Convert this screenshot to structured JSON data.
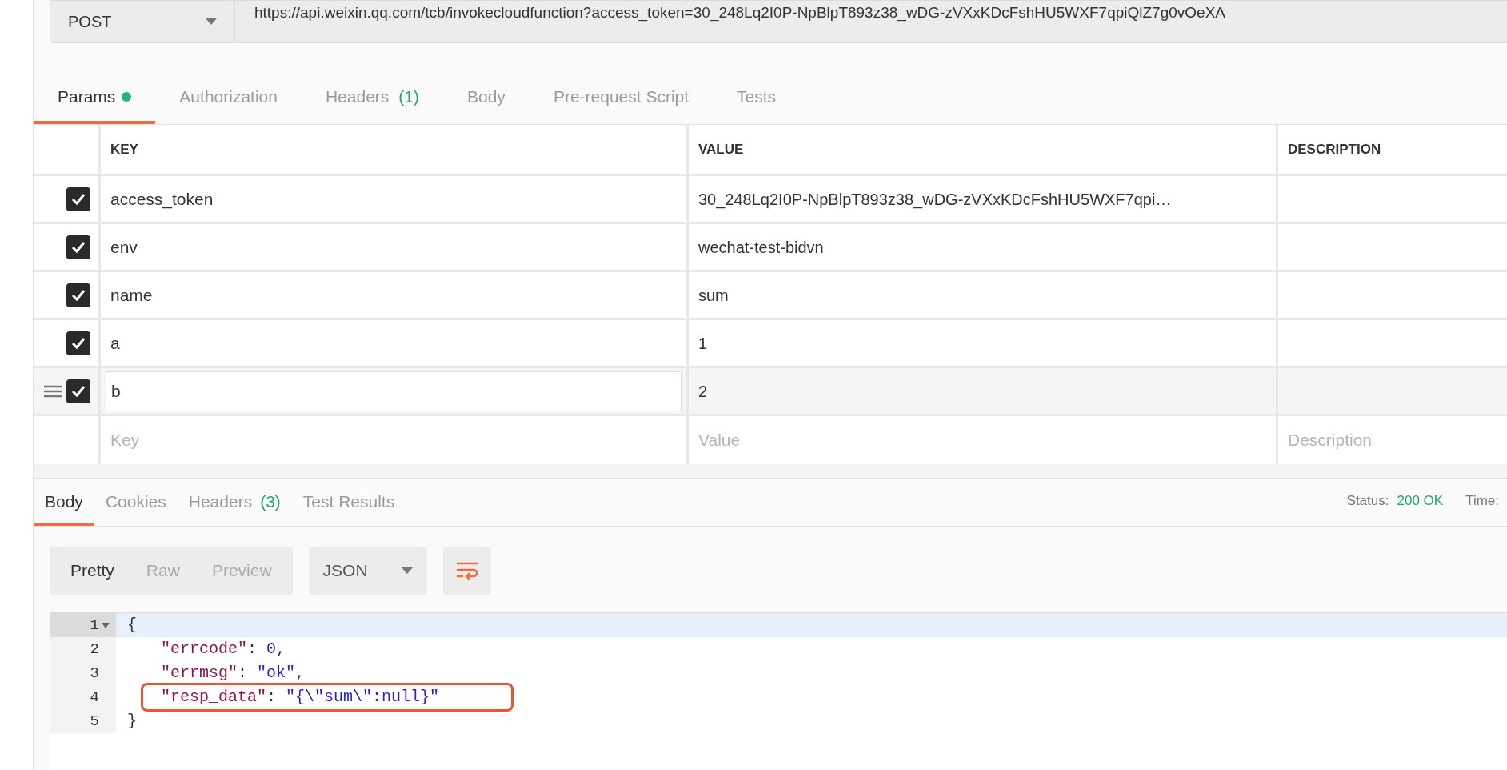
{
  "request": {
    "method": "POST",
    "url": "https://api.weixin.qq.com/tcb/invokecloudfunction?access_token=30_248Lq2I0P-NpBlpT893z38_wDG-zVXxKDcFshHU5WXF7qpiQlZ7g0vOeXA"
  },
  "request_tabs": [
    {
      "label": "Params",
      "dot": true,
      "selected": true
    },
    {
      "label": "Authorization",
      "dot": false,
      "selected": false
    },
    {
      "label": "Headers",
      "count": "(1)",
      "dot": false,
      "selected": false
    },
    {
      "label": "Body",
      "dot": false,
      "selected": false
    },
    {
      "label": "Pre-request Script",
      "dot": false,
      "selected": false
    },
    {
      "label": "Tests",
      "dot": false,
      "selected": false
    }
  ],
  "params": {
    "columns": [
      "KEY",
      "VALUE",
      "DESCRIPTION"
    ],
    "rows": [
      {
        "checked": true,
        "focused": false,
        "key": "access_token",
        "value": "30_248Lq2I0P-NpBlpT893z38_wDG-zVXxKDcFshHU5WXF7qpi…"
      },
      {
        "checked": true,
        "focused": false,
        "key": "env",
        "value": "wechat-test-bidvn"
      },
      {
        "checked": true,
        "focused": false,
        "key": "name",
        "value": "sum"
      },
      {
        "checked": true,
        "focused": false,
        "key": "a",
        "value": "1"
      },
      {
        "checked": true,
        "focused": true,
        "key": "b",
        "value": "2"
      }
    ],
    "new_row": {
      "key_placeholder": "Key",
      "value_placeholder": "Value",
      "description_placeholder": "Description"
    }
  },
  "response_tabs": [
    {
      "label": "Body",
      "selected": true
    },
    {
      "label": "Cookies",
      "selected": false
    },
    {
      "label": "Headers",
      "count": "(3)",
      "selected": false
    },
    {
      "label": "Test Results",
      "selected": false
    }
  ],
  "status": {
    "label": "Status:",
    "value": "200 OK",
    "time_label": "Time:"
  },
  "view_modes": [
    {
      "label": "Pretty",
      "selected": true
    },
    {
      "label": "Raw",
      "selected": false
    },
    {
      "label": "Preview",
      "selected": false
    }
  ],
  "format": "JSON",
  "code": [
    {
      "number": "1",
      "foldable": true,
      "current": true,
      "boxed": false,
      "indented": false,
      "tokens": [
        {
          "kind": "punct",
          "text": "{"
        }
      ]
    },
    {
      "number": "2",
      "foldable": false,
      "current": false,
      "boxed": false,
      "indented": true,
      "tokens": [
        {
          "kind": "key",
          "text": "\"errcode\""
        },
        {
          "kind": "punct",
          "text": ": "
        },
        {
          "kind": "number",
          "text": "0"
        },
        {
          "kind": "punct",
          "text": ","
        }
      ]
    },
    {
      "number": "3",
      "foldable": false,
      "current": false,
      "boxed": false,
      "indented": true,
      "tokens": [
        {
          "kind": "key",
          "text": "\"errmsg\""
        },
        {
          "kind": "punct",
          "text": ": "
        },
        {
          "kind": "string",
          "text": "\"ok\""
        },
        {
          "kind": "punct",
          "text": ","
        }
      ]
    },
    {
      "number": "4",
      "foldable": false,
      "current": false,
      "boxed": true,
      "indented": true,
      "tokens": [
        {
          "kind": "key",
          "text": "\"resp_data\""
        },
        {
          "kind": "punct",
          "text": ": "
        },
        {
          "kind": "string",
          "text": "\"{\\\"sum\\\":null}\""
        }
      ]
    },
    {
      "number": "5",
      "foldable": false,
      "current": false,
      "boxed": false,
      "indented": false,
      "tokens": [
        {
          "kind": "punct",
          "text": "}"
        }
      ]
    }
  ]
}
